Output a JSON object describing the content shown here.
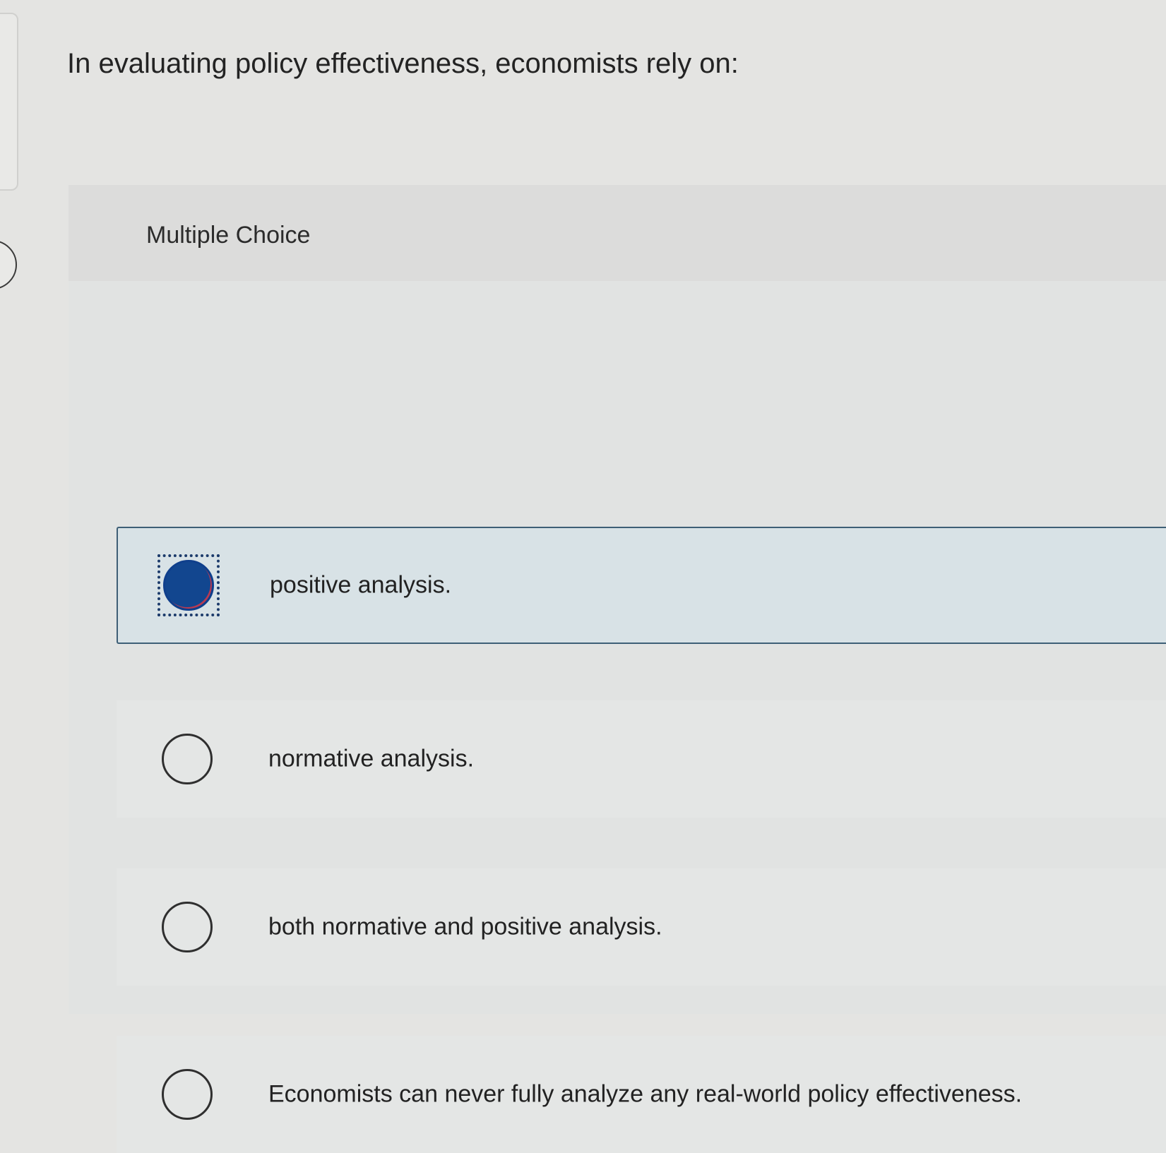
{
  "question": {
    "text": "In evaluating policy effectiveness, economists rely on:",
    "type_label": "Multiple Choice"
  },
  "options": [
    {
      "label": "positive analysis.",
      "selected": true
    },
    {
      "label": "normative analysis.",
      "selected": false
    },
    {
      "label": "both normative and positive analysis.",
      "selected": false
    },
    {
      "label": "Economists can never fully analyze any real-world policy effectiveness.",
      "selected": false
    }
  ],
  "colors": {
    "selected_fill": "#12468f",
    "selected_border": "#3e5f76",
    "selected_background": "#d8e2e6"
  }
}
